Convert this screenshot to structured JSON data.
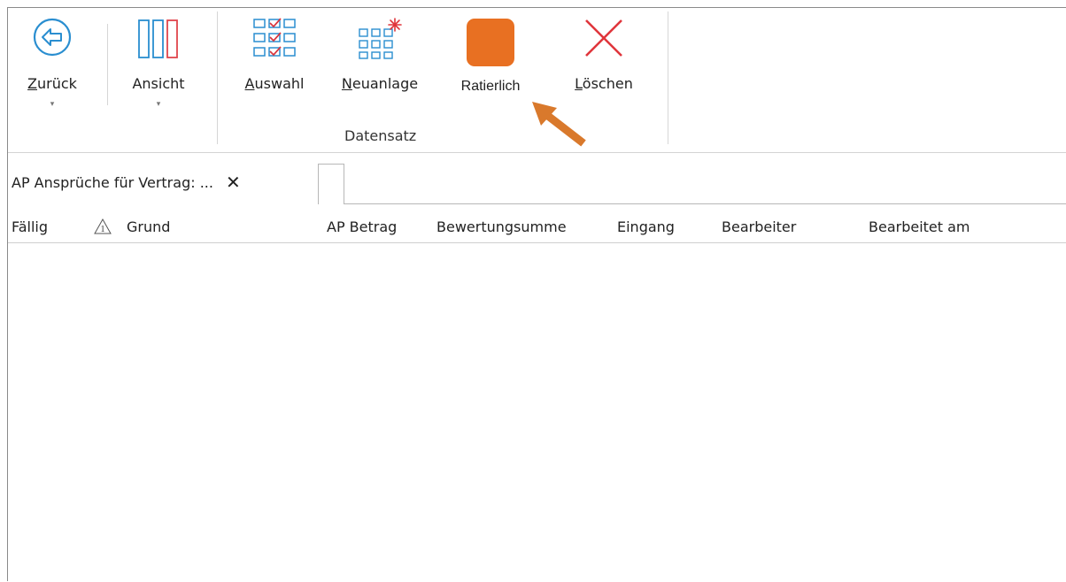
{
  "ribbon": {
    "zurueck": {
      "label_u": "Z",
      "label_rest": "urück",
      "dropdown": "▾"
    },
    "ansicht": {
      "label": "Ansicht",
      "dropdown": "▾"
    },
    "auswahl": {
      "label_u": "A",
      "label_rest": "uswahl"
    },
    "neuanlage": {
      "label_u": "N",
      "label_rest": "euanlage"
    },
    "ratierlich": {
      "label": "Ratierlich",
      "color": "#E87022"
    },
    "loeschen": {
      "label_u": "L",
      "label_rest": "öschen"
    },
    "group_datensatz": "Datensatz",
    "accent": "#2a8ed0",
    "arrow_color": "#D9792C"
  },
  "tabs": [
    {
      "label": "AP Ansprüche für  Vertrag: ...",
      "close": "✕"
    }
  ],
  "columns": {
    "faellig": "Fällig",
    "warn_digit": "1",
    "grund": "Grund",
    "ap_betrag": "AP Betrag",
    "bewertungsumme": "Bewertungsumme",
    "eingang": "Eingang",
    "bearbeiter": "Bearbeiter",
    "bearbeitet_am": "Bearbeitet am"
  }
}
